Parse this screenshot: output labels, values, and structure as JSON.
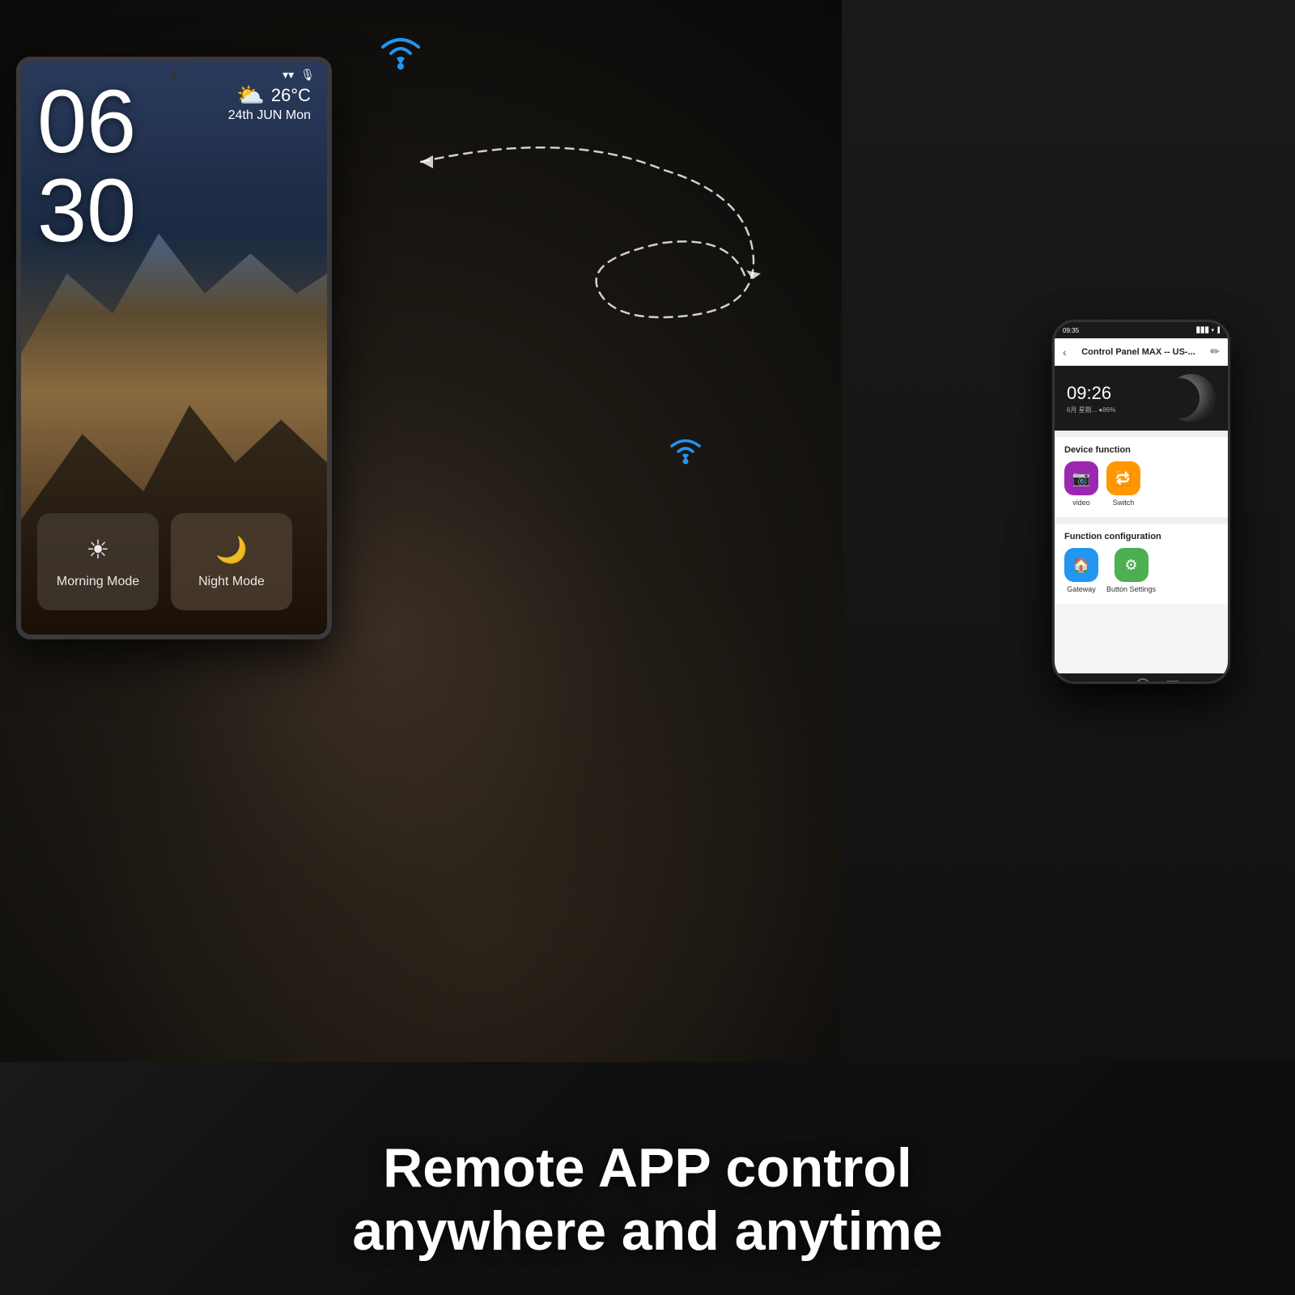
{
  "scene": {
    "tagline_line1": "Remote APP control",
    "tagline_line2": "anywhere and anytime"
  },
  "tablet": {
    "clock_hour": "06",
    "clock_minute": "30",
    "weather_icon": "⛅",
    "weather_temp": "26°C",
    "weather_date": "24th JUN  Mon",
    "morning_mode_label": "Morning Mode",
    "night_mode_label": "Night Mode",
    "morning_icon": "☀",
    "night_icon": "🌙"
  },
  "phone": {
    "status_time": "09:35",
    "header_title": "Control Panel MAX -- US-...",
    "preview_time": "09:26",
    "preview_date": "6月星期... ●86% ◉",
    "device_function_label": "Device function",
    "function_config_label": "Function configuration",
    "functions": [
      {
        "label": "video",
        "color": "purple",
        "icon": "📷"
      },
      {
        "label": "Switch",
        "color": "orange",
        "icon": "🔁"
      }
    ],
    "configs": [
      {
        "label": "Gateway",
        "color": "blue",
        "icon": "🔌"
      },
      {
        "label": "Button Settings",
        "color": "green",
        "icon": "⚙"
      }
    ],
    "nav_back": "‹",
    "nav_edit": "✏"
  },
  "wifi_icons": {
    "tablet_wifi_unicode": "📶",
    "phone_wifi_unicode": "📶"
  }
}
